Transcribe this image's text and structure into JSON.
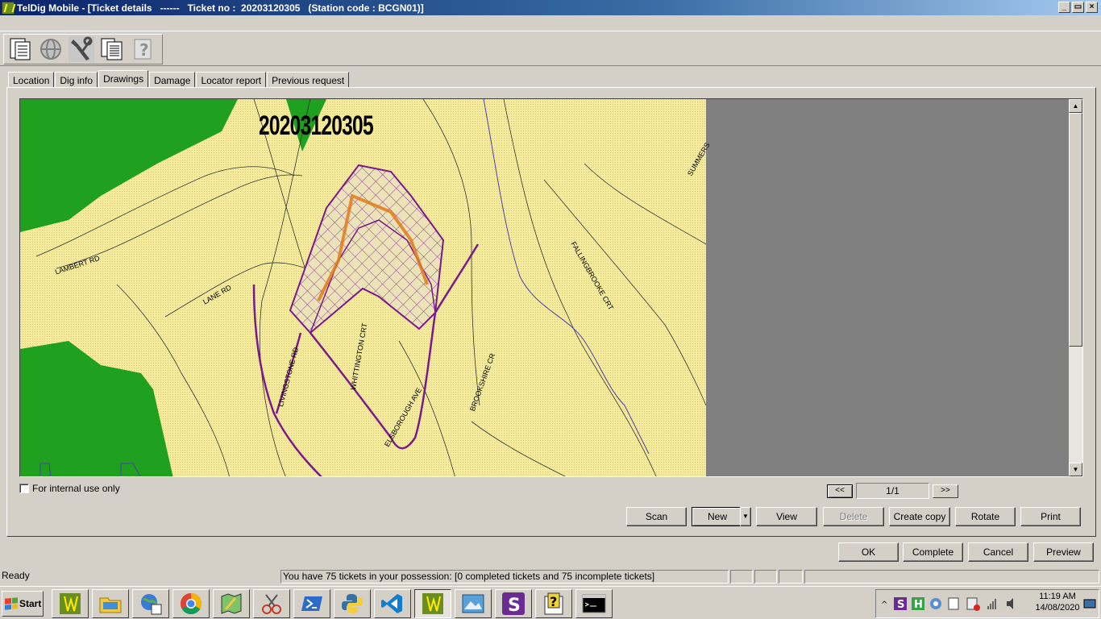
{
  "window": {
    "title": "TelDig Mobile - [Ticket details   ------   Ticket no :  20203120305   (Station code : BCGN01)]",
    "controls": [
      "_",
      "▭",
      "×"
    ]
  },
  "toolbar": {
    "buttons": [
      {
        "icon": "document-list-icon"
      },
      {
        "icon": "globe-icon"
      },
      {
        "icon": "tools-icon"
      },
      {
        "icon": "documents-icon"
      },
      {
        "icon": "help-icon"
      }
    ]
  },
  "tabs": [
    "Location",
    "Dig info",
    "Drawings",
    "Damage",
    "Locator report",
    "Previous request"
  ],
  "active_tab": "Drawings",
  "drawing": {
    "ticket_label": "20203120305",
    "street_labels": [
      "LAMBERT RD",
      "LANE RD",
      "LIVINGSTONE RD",
      "WHITTINGTON CRT",
      "ELSBOROUGH AVE",
      "BROOKSHIRE CR",
      "FALLINGBROOKE CRT",
      "SUMMERS"
    ],
    "colors": {
      "land": "#f6eb9c",
      "park": "#1fa01f",
      "dig_area": "#7a1a8a",
      "route": "#e07b1a"
    }
  },
  "internal_use": {
    "label": "For internal use only",
    "checked": false
  },
  "page_nav": {
    "prev": "<<",
    "page": "1/1",
    "next": ">>"
  },
  "drawing_buttons": {
    "scan": "Scan",
    "new": "New",
    "view": "View",
    "delete": "Delete",
    "create_copy": "Create copy",
    "rotate": "Rotate",
    "print": "Print"
  },
  "dialog_buttons": {
    "ok": "OK",
    "complete": "Complete",
    "cancel": "Cancel",
    "preview": "Preview"
  },
  "status": {
    "state": "Ready",
    "message": "You have 75 tickets in your possession:  [0 completed tickets and 75 incomplete tickets]"
  },
  "taskbar": {
    "start": "Start",
    "time": "11:19 AM",
    "date": "14/08/2020"
  }
}
